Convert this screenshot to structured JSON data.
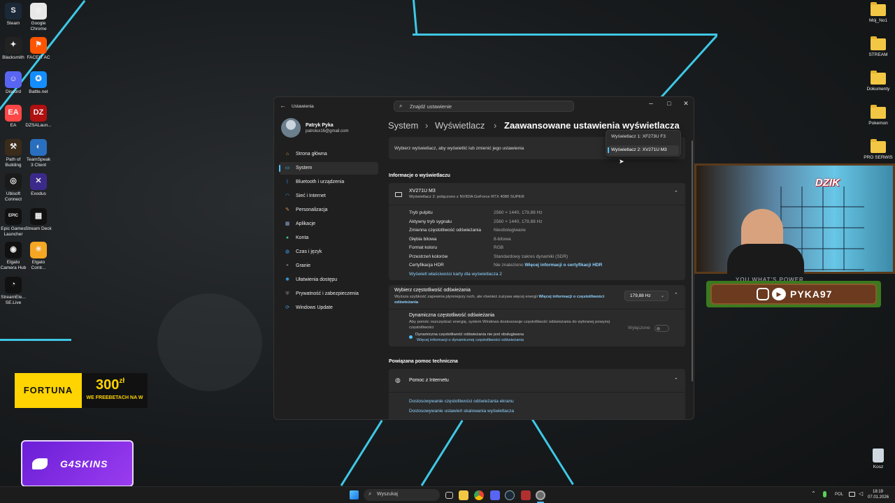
{
  "desktop": {
    "left_icons": [
      {
        "label": "Steam",
        "color": "#1b2838",
        "glyph": "S"
      },
      {
        "label": "Google Chrome",
        "color": "#e8e8e8",
        "glyph": "◉"
      },
      {
        "label": "Blacksmith",
        "color": "#222",
        "glyph": "✦"
      },
      {
        "label": "FACEIT AC",
        "color": "#ff5500",
        "glyph": "⚑"
      },
      {
        "label": "Discord",
        "color": "#5865f2",
        "glyph": "☺"
      },
      {
        "label": "Battle.net",
        "color": "#148eff",
        "glyph": "✪"
      },
      {
        "label": "EA",
        "color": "#ff4747",
        "glyph": "EA"
      },
      {
        "label": "DZSALaun...",
        "color": "#b01010",
        "glyph": "DZ"
      },
      {
        "label": "Path of Building",
        "color": "#3b2b1b",
        "glyph": "⚒"
      },
      {
        "label": "TeamSpeak 3 Client",
        "color": "#2a6fbf",
        "glyph": "◐"
      },
      {
        "label": "Ubisoft Connect",
        "color": "#1a1a1a",
        "glyph": "◎"
      },
      {
        "label": "Exodus",
        "color": "#3b2a8a",
        "glyph": "✕"
      },
      {
        "label": "Epic Games Launcher",
        "color": "#111",
        "glyph": "EPIC"
      },
      {
        "label": "Stream Deck",
        "color": "#111",
        "glyph": "▦"
      },
      {
        "label": "Elgato Camera Hub",
        "color": "#111",
        "glyph": "◉"
      },
      {
        "label": "Elgato Contr...",
        "color": "#f5a623",
        "glyph": "☀"
      },
      {
        "label": "StreamEle... SE.Live",
        "color": "#111",
        "glyph": "◔"
      }
    ],
    "right_icons": [
      {
        "label": "Mój_No1"
      },
      {
        "label": "STREAM"
      },
      {
        "label": "Dokumenty"
      },
      {
        "label": "Pokemon"
      },
      {
        "label": "PRO SERWIS"
      }
    ],
    "recycle_bin": "Kosz",
    "ads": {
      "fortuna_brand": "FORTUNA",
      "fortuna_amount": "300",
      "fortuna_currency": "zł",
      "fortuna_sub": "WE FREEBETACH NA W",
      "g4skins": "G4SKINS"
    },
    "overlay": {
      "logo": "DZIK",
      "social_handle": "PYKA97",
      "scroll_text": "YOU WHAT'S POWER"
    }
  },
  "window": {
    "app_title": "Ustawienia",
    "search_placeholder": "Znajdź ustawienie",
    "controls": {
      "minimize": "–",
      "maximize": "□",
      "close": "✕"
    },
    "user": {
      "name": "Patryk Pyka",
      "email": "patrolux16@gmail.com"
    },
    "nav": [
      {
        "label": "Strona główna",
        "icon": "home-icon",
        "glyph": "⌂",
        "color": "#e9a23b"
      },
      {
        "label": "System",
        "icon": "monitor-icon",
        "glyph": "▭",
        "color": "#4cc2ff",
        "selected": true
      },
      {
        "label": "Bluetooth i urządzenia",
        "icon": "bluetooth-icon",
        "glyph": "ᛒ",
        "color": "#2f7dd6"
      },
      {
        "label": "Sieć i Internet",
        "icon": "wifi-icon",
        "glyph": "◠",
        "color": "#3aa0e8"
      },
      {
        "label": "Personalizacja",
        "icon": "brush-icon",
        "glyph": "✎",
        "color": "#e8955a"
      },
      {
        "label": "Aplikacje",
        "icon": "apps-icon",
        "glyph": "▦",
        "color": "#8aa2c8"
      },
      {
        "label": "Konta",
        "icon": "account-icon",
        "glyph": "●",
        "color": "#3fbf7f"
      },
      {
        "label": "Czas i język",
        "icon": "globe-icon",
        "glyph": "◍",
        "color": "#3aa0e8"
      },
      {
        "label": "Granie",
        "icon": "gamepad-icon",
        "glyph": "◓",
        "color": "#9a9a9a"
      },
      {
        "label": "Ułatwienia dostępu",
        "icon": "accessibility-icon",
        "glyph": "✱",
        "color": "#3aa0e8"
      },
      {
        "label": "Prywatność i zabezpieczenia",
        "icon": "shield-icon",
        "glyph": "⛨",
        "color": "#8a8a8a"
      },
      {
        "label": "Windows Update",
        "icon": "update-icon",
        "glyph": "⟳",
        "color": "#3aa0e8"
      }
    ],
    "breadcrumb": {
      "part1": "System",
      "part2": "Wyświetlacz",
      "part3": "Zaawansowane ustawienia wyświetlacza",
      "sep": "›"
    },
    "select_display": {
      "label": "Wybierz wyświetlacz, aby wyświetlić lub zmienić jego ustawienia",
      "options": [
        "Wyświetlacz 1: XF273U F3",
        "Wyświetlacz 2: XV271U M3"
      ],
      "selected_index": 1
    },
    "info_section": "Informacje o wyświetlaczu",
    "monitor": {
      "name": "XV271U M3",
      "sub": "Wyświetlacz 2: połączono z NVIDIA GeForce RTX 4080 SUPER",
      "rows": [
        {
          "k": "Tryb pulpitu",
          "v": "2560 × 1440, 179,88 Hz"
        },
        {
          "k": "Aktywny tryb sygnału",
          "v": "2560 × 1440, 179,88 Hz"
        },
        {
          "k": "Zmienna częstotliwość odświeżania",
          "v": "Nieobsługiwane"
        },
        {
          "k": "Głębia bitowa",
          "v": "8-bitowa"
        },
        {
          "k": "Format koloru",
          "v": "RGB"
        },
        {
          "k": "Przestrzeń kolorów",
          "v": "Standardowy zakres dynamiki (SDR)"
        }
      ],
      "hdr_key": "Certyfikacja HDR",
      "hdr_value": "Nie znaleziono",
      "hdr_link": "Więcej informacji o certyfikacji HDR",
      "adapter_link": "Wyświetl właściwości karty dla wyświetlacza 2"
    },
    "refresh": {
      "title": "Wybierz częstotliwość odświeżania",
      "desc": "Wyższa szybkość zapewnia płynniejszy ruch, ale również zużywa więcej energii",
      "link": "Więcej informacji o częstotliwości odświeżania",
      "value": "179,88 Hz"
    },
    "dynamic": {
      "title": "Dynamiczna częstotliwość odświeżania",
      "desc": "Aby pomóc oszczędzać energię, system Windows dostosowuje częstotliwość odświeżania do wybranej powyżej częstotliwości",
      "note": "Dynamiczna częstotliwość odświeżania nie jest obsługiwana",
      "note_link": "Więcej informacji o dynamicznej częstotliwości odświeżania",
      "toggle_label": "Wyłączone",
      "toggle_on": false
    },
    "related": "Powiązana pomoc techniczna",
    "help": {
      "title": "Pomoc z Internetu",
      "links": [
        "Dostosowywanie częstotliwości odświeżania ekranu",
        "Dostosowywanie ustawień skalowania wyświetlacza"
      ]
    }
  },
  "taskbar": {
    "search": "Wyszukaj",
    "lang": "POL",
    "time": "18:19",
    "date": "07.01.2026"
  }
}
